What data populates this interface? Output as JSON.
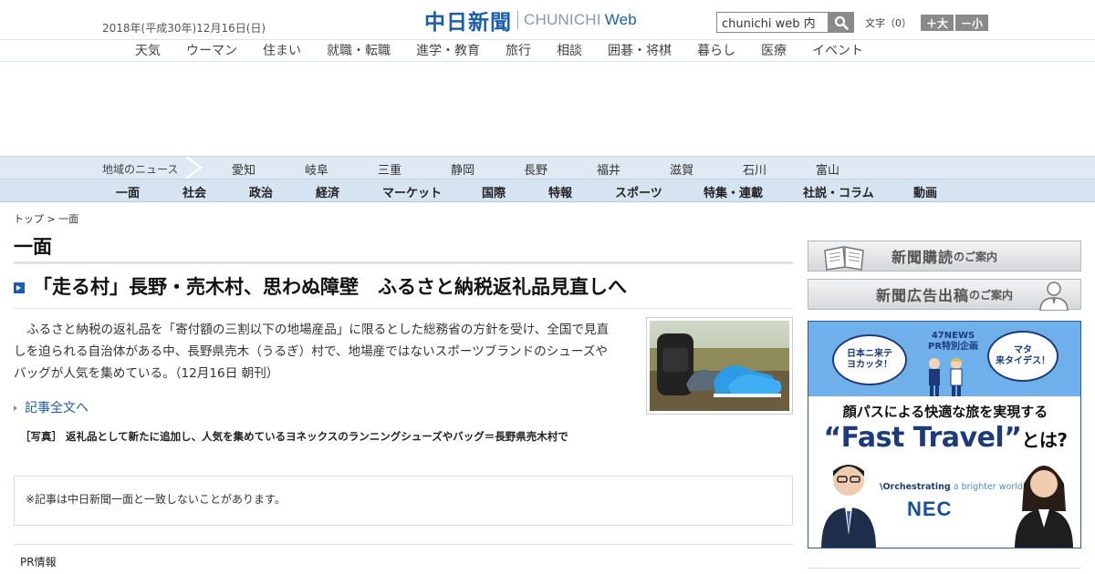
{
  "header": {
    "date": "2018年(平成30年)12月16日(日)",
    "logo_jp": "中日新聞",
    "logo_en": "CHUNICHI",
    "logo_web": "Web",
    "search_value": "chunichi web 内",
    "font_label": "文字（0）",
    "font_larger": "＋大",
    "font_smaller": "－小"
  },
  "categories": [
    "天気",
    "ウーマン",
    "住まい",
    "就職・転職",
    "進学・教育",
    "旅行",
    "相談",
    "囲碁・将棋",
    "暮らし",
    "医療",
    "イベント"
  ],
  "region": {
    "label": "地域のニュース",
    "items": [
      "愛知",
      "岐阜",
      "三重",
      "静岡",
      "長野",
      "福井",
      "滋賀",
      "石川",
      "富山"
    ]
  },
  "sections": [
    "一面",
    "社会",
    "政治",
    "経済",
    "マーケット",
    "国際",
    "特報",
    "スポーツ",
    "特集・連載",
    "社説・コラム",
    "動画"
  ],
  "breadcrumb": {
    "home": "トップ",
    "sep": " > ",
    "current": "一面"
  },
  "page_title": "一面",
  "article": {
    "headline": "「走る村」長野・売木村、思わぬ障壁　ふるさと納税返礼品見直しへ",
    "lead": "ふるさと納税の返礼品を「寄付額の三割以下の地場産品」に限るとした総務省の方針を受け、全国で見直しを迫られる自治体がある中、長野県売木（うるぎ）村で、地場産ではないスポーツブランドのシューズやバッグが人気を集めている。（12月16日 朝刊）",
    "more_link": "記事全文へ",
    "caption": "［写真］ 返礼品として新たに追加し、人気を集めているヨネックスのランニングシューズやバッグ＝長野県売木村で"
  },
  "note": "※記事は中日新聞一面と一致しないことがあります。",
  "pr_label": "PR情報",
  "sidebar": {
    "subscribe_big": "新聞購読",
    "subscribe_small": "のご案内",
    "ad_big": "新聞広告出稿",
    "ad_small": "のご案内"
  },
  "ad": {
    "bubble_left": "日本ニ来テ\nヨカッタ！",
    "bubble_right": "マタ\n来タイデス！",
    "news_line1": "47NEWS",
    "news_line2": "PR特別企画",
    "headline": "顔パスによる快適な旅を実現する",
    "big_text": "“Fast Travel”",
    "big_suffix": "とは?",
    "orch_prefix": "\\Orchestrating",
    "orch_suffix": "a brighter world",
    "brand": "NEC"
  },
  "colors": {
    "brand_blue": "#1a5fae",
    "region_bg": "#dfe9f4",
    "section_bg": "#d6e3f1"
  }
}
